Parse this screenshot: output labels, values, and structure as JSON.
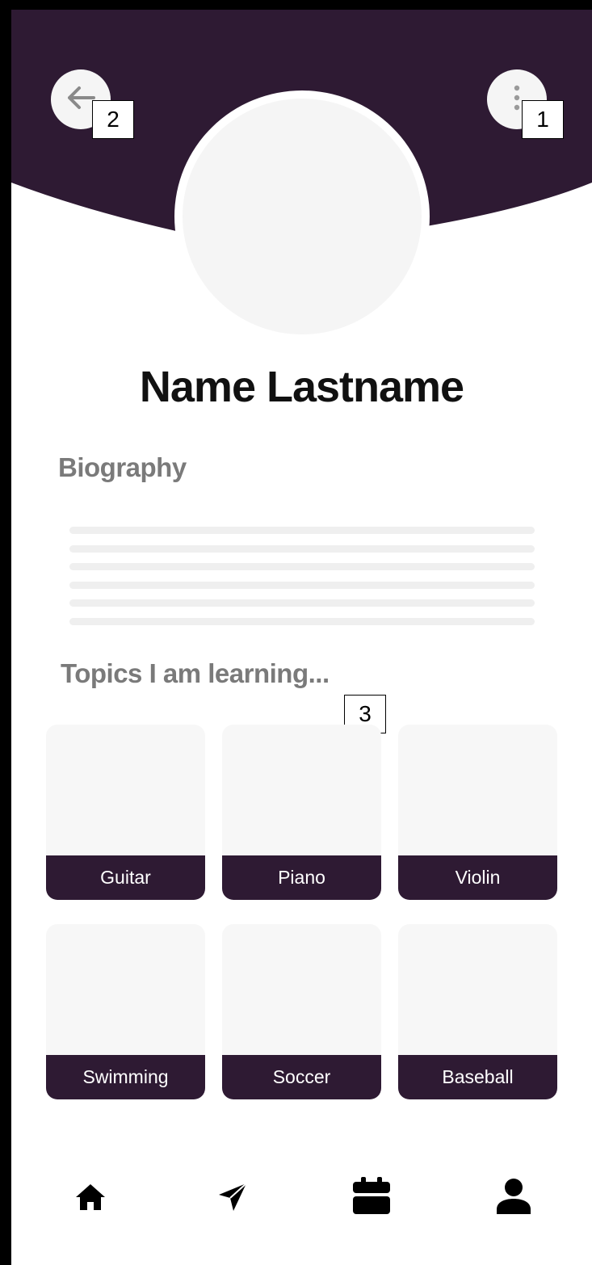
{
  "profile": {
    "name": "Name Lastname"
  },
  "sections": {
    "biography_title": "Biography",
    "topics_title": "Topics I am learning..."
  },
  "topics": [
    {
      "label": "Guitar"
    },
    {
      "label": "Piano"
    },
    {
      "label": "Violin"
    },
    {
      "label": "Swimming"
    },
    {
      "label": "Soccer"
    },
    {
      "label": "Baseball"
    }
  ],
  "markers": {
    "m1": "1",
    "m2": "2",
    "m3": "3"
  },
  "icons": {
    "back": "arrow-left-icon",
    "more": "more-vertical-icon",
    "nav": [
      "home-icon",
      "send-icon",
      "calendar-icon",
      "user-icon"
    ]
  },
  "colors": {
    "header": "#2e1a33",
    "placeholder": "#f5f5f5"
  }
}
